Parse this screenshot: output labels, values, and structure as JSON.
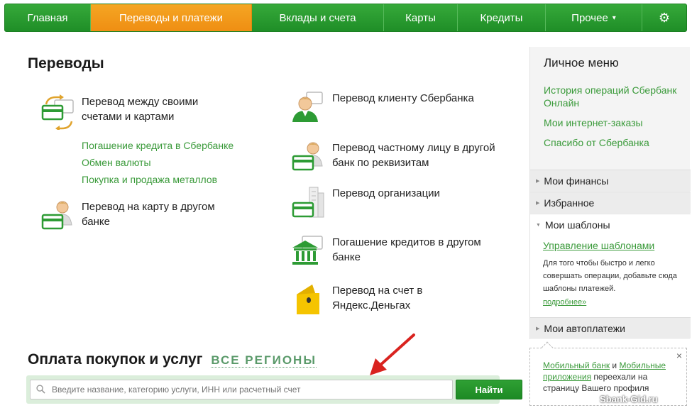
{
  "nav": {
    "items": [
      {
        "label": "Главная"
      },
      {
        "label": "Переводы и платежи"
      },
      {
        "label": "Вклады и счета"
      },
      {
        "label": "Карты"
      },
      {
        "label": "Кредиты"
      },
      {
        "label": "Прочее",
        "caret": "▾"
      }
    ],
    "settings_icon": "⚙"
  },
  "transfers": {
    "title": "Переводы",
    "own_accounts": "Перевод между своими счетами и картами",
    "sublinks": [
      "Погашение кредита в Сбербанке",
      "Обмен валюты",
      "Покупка и продажа металлов"
    ],
    "card_other_bank": "Перевод на карту в другом банке",
    "sber_client": "Перевод клиенту Сбербанка",
    "private_person": "Перевод частному лицу в другой банк по реквизитам",
    "organization": "Перевод организации",
    "loans_other_bank": "Погашение кредитов в другом банке",
    "yandex": "Перевод на счет в Яндекс.Деньгах"
  },
  "payments": {
    "title": "Оплата покупок и услуг",
    "regions": "ВСЕ РЕГИОНЫ",
    "search_placeholder": "Введите название, категорию услуги, ИНН или расчетный счет",
    "find_button": "Найти"
  },
  "personal_menu": {
    "title": "Личное меню",
    "links": [
      "История операций Сбербанк Онлайн",
      "Мои интернет-заказы",
      "Спасибо от Сбербанка"
    ],
    "sections": {
      "finances": "Мои финансы",
      "favorites": "Избранное",
      "templates": "Мои шаблоны",
      "autopay": "Мои автоплатежи"
    },
    "templates_manage": "Управление шаблонами",
    "templates_desc": "Для того чтобы быстро и легко совершать операции, добавьте сюда шаблоны платежей.",
    "templates_more": "подробнее»"
  },
  "notice": {
    "link1": "Мобильный банк",
    "and": " и ",
    "link2": "Мобильные приложения",
    "rest": " переехали на страницу Вашего профиля",
    "close": "×"
  },
  "watermark": "Sbank-Gid.ru"
}
